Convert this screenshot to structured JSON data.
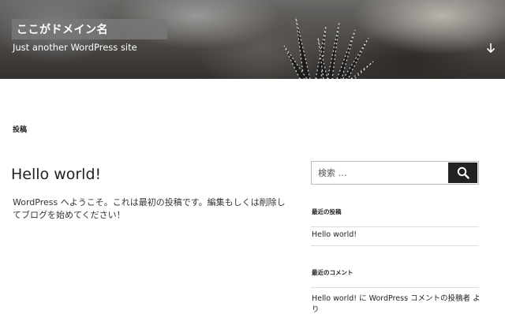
{
  "header": {
    "site_title": "ここがドメイン名",
    "tagline": "Just another WordPress site",
    "scroll_icon": "arrow-down-icon"
  },
  "main": {
    "posts_heading": "投稿",
    "post": {
      "title": "Hello world!",
      "content": "WordPress へようこそ。これは最初の投稿です。編集もしくは削除してブログを始めてください！"
    }
  },
  "sidebar": {
    "search": {
      "placeholder": "検索 …",
      "button_icon": "search-icon"
    },
    "recent_posts": {
      "title": "最近の投稿",
      "items": [
        "Hello world!"
      ]
    },
    "recent_comments": {
      "title": "最近のコメント",
      "first_line": "Hello world! に WordPress コメントの投稿者 よ",
      "second_line": "り"
    }
  },
  "colors": {
    "dark": "#222222",
    "divider": "#dddddd",
    "title_box": "#787878"
  }
}
